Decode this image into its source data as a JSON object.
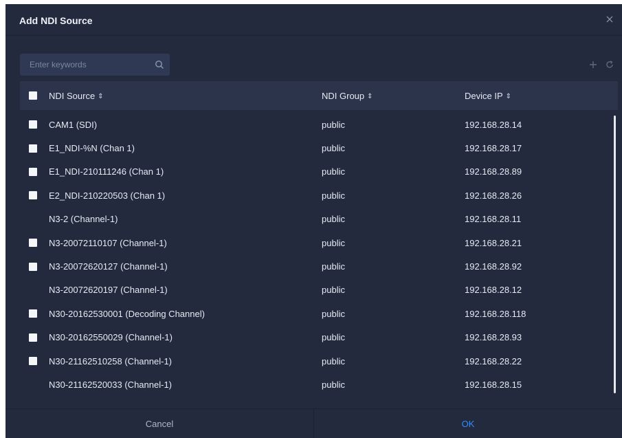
{
  "dialog": {
    "title": "Add NDI Source",
    "close_icon": "close-icon"
  },
  "search": {
    "placeholder": "Enter keywords",
    "value": "",
    "icon": "search-icon"
  },
  "toolbar": {
    "add_icon": "plus-icon",
    "refresh_icon": "refresh-icon"
  },
  "table": {
    "columns": [
      "NDI Source",
      "NDI Group",
      "Device IP"
    ],
    "sort_glyph": "⇕",
    "rows": [
      {
        "source": "CAM1 (SDI)",
        "group": "public",
        "ip": "192.168.28.14",
        "checkbox": true
      },
      {
        "source": "E1_NDI-%N (Chan 1)",
        "group": "public",
        "ip": "192.168.28.17",
        "checkbox": true
      },
      {
        "source": "E1_NDI-210111246 (Chan 1)",
        "group": "public",
        "ip": "192.168.28.89",
        "checkbox": true
      },
      {
        "source": "E2_NDI-210220503 (Chan 1)",
        "group": "public",
        "ip": "192.168.28.26",
        "checkbox": true
      },
      {
        "source": "N3-2 (Channel-1)",
        "group": "public",
        "ip": "192.168.28.11",
        "checkbox": false
      },
      {
        "source": "N3-20072110107 (Channel-1)",
        "group": "public",
        "ip": "192.168.28.21",
        "checkbox": true
      },
      {
        "source": "N3-20072620127 (Channel-1)",
        "group": "public",
        "ip": "192.168.28.92",
        "checkbox": true
      },
      {
        "source": "N3-20072620197 (Channel-1)",
        "group": "public",
        "ip": "192.168.28.12",
        "checkbox": false
      },
      {
        "source": "N30-20162530001 (Decoding Channel)",
        "group": "public",
        "ip": "192.168.28.118",
        "checkbox": true
      },
      {
        "source": "N30-20162550029 (Channel-1)",
        "group": "public",
        "ip": "192.168.28.93",
        "checkbox": true
      },
      {
        "source": "N30-21162510258 (Channel-1)",
        "group": "public",
        "ip": "192.168.28.22",
        "checkbox": true
      },
      {
        "source": "N30-21162520033 (Channel-1)",
        "group": "public",
        "ip": "192.168.28.15",
        "checkbox": false
      }
    ]
  },
  "footer": {
    "cancel_label": "Cancel",
    "ok_label": "OK"
  },
  "colors": {
    "background": "#232a3e",
    "header_row": "#2b344b",
    "search_field": "#2f3953",
    "accent": "#2f8cff"
  }
}
